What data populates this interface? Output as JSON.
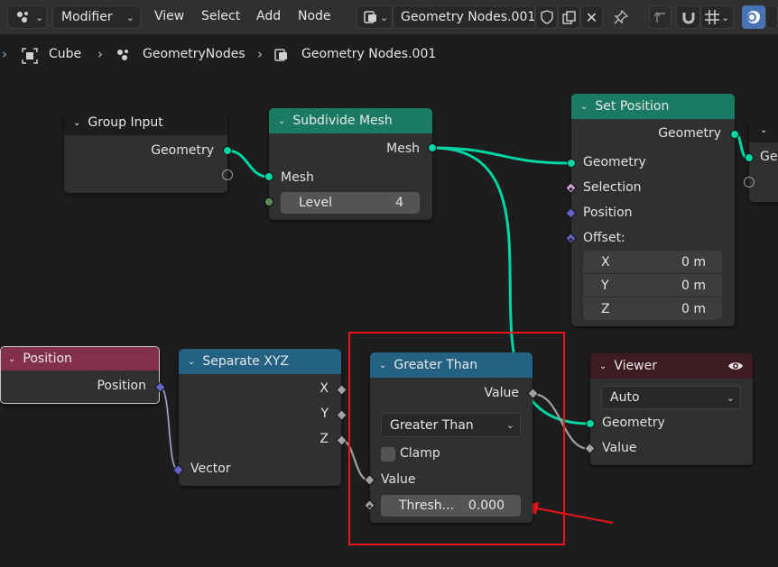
{
  "topbar": {
    "editor_menu": "Modifier",
    "menus": [
      "View",
      "Select",
      "Add",
      "Node"
    ],
    "node_tree_name": "Geometry Nodes.001"
  },
  "breadcrumb": {
    "items": [
      "Cube",
      "GeometryNodes",
      "Geometry Nodes.001"
    ]
  },
  "colors": {
    "group_header": "#1d1d1d",
    "geometry_header": "#1b7a64",
    "input_header": "#83314a",
    "converter_header": "#246283",
    "output_header": "#3e1a23",
    "geometry_socket": "#00d6a3",
    "link_float": "#a1a1a1",
    "highlight": "#e8141a"
  },
  "nodes": {
    "group_input": {
      "title": "Group Input",
      "outputs": [
        "Geometry"
      ]
    },
    "subdivide_mesh": {
      "title": "Subdivide Mesh",
      "output": "Mesh",
      "input": "Mesh",
      "level_label": "Level",
      "level_value": "4"
    },
    "set_position": {
      "title": "Set Position",
      "output": "Geometry",
      "inputs": [
        "Geometry",
        "Selection",
        "Position",
        "Offset:"
      ],
      "offset": [
        {
          "axis": "X",
          "value": "0 m"
        },
        {
          "axis": "Y",
          "value": "0 m"
        },
        {
          "axis": "Z",
          "value": "0 m"
        }
      ]
    },
    "partial_node": {
      "socket_label": "Ge"
    },
    "position": {
      "title": "Position",
      "output": "Position"
    },
    "separate_xyz": {
      "title": "Separate XYZ",
      "outputs": [
        "X",
        "Y",
        "Z"
      ],
      "input": "Vector"
    },
    "greater_than": {
      "title": "Greater Than",
      "output": "Value",
      "operation": "Greater Than",
      "clamp_label": "Clamp",
      "input_value": "Value",
      "threshold_label": "Thresh...",
      "threshold_value": "0.000"
    },
    "viewer": {
      "title": "Viewer",
      "domain": "Auto",
      "inputs": [
        "Geometry",
        "Value"
      ]
    }
  }
}
